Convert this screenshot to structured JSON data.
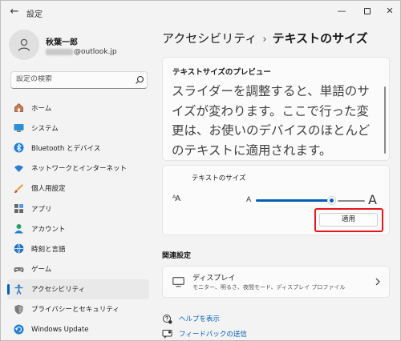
{
  "window": {
    "title": "設定",
    "back_glyph": "←",
    "minimize_glyph": "—",
    "close_glyph": "✕"
  },
  "user": {
    "name": "秋葉一郎",
    "email_domain": "@outlook.jp"
  },
  "search": {
    "placeholder": "設定の検索"
  },
  "nav": {
    "items": [
      {
        "label": "ホーム",
        "icon": "home-icon"
      },
      {
        "label": "システム",
        "icon": "system-icon"
      },
      {
        "label": "Bluetooth とデバイス",
        "icon": "bluetooth-icon"
      },
      {
        "label": "ネットワークとインターネット",
        "icon": "network-icon"
      },
      {
        "label": "個人用設定",
        "icon": "brush-icon"
      },
      {
        "label": "アプリ",
        "icon": "apps-icon"
      },
      {
        "label": "アカウント",
        "icon": "account-icon"
      },
      {
        "label": "時刻と言語",
        "icon": "time-language-icon"
      },
      {
        "label": "ゲーム",
        "icon": "gaming-icon"
      },
      {
        "label": "アクセシビリティ",
        "icon": "accessibility-icon"
      },
      {
        "label": "プライバシーとセキュリティ",
        "icon": "shield-icon"
      },
      {
        "label": "Windows Update",
        "icon": "update-icon"
      }
    ],
    "active_index": 9
  },
  "breadcrumb": {
    "parent": "アクセシビリティ",
    "separator": "›",
    "current": "テキストのサイズ"
  },
  "preview": {
    "title": "テキストサイズのプレビュー",
    "text": "スライダーを調整すると、単語のサイズが変わります。ここで行った変更は、お使いのデバイスのほとんどのテキストに適用されます。"
  },
  "text_size": {
    "label": "テキストのサイズ",
    "aa_glyph": "ᴬA",
    "small_a": "A",
    "large_a": "A",
    "slider_fraction": 0.7,
    "apply_label": "適用"
  },
  "related": {
    "header": "関連設定",
    "display_title": "ディスプレイ",
    "display_subtitle": "モニター、明るさ、夜間モード、ディスプレイ プロファイル"
  },
  "links": {
    "help": "ヘルプを表示",
    "feedback": "フィードバックの送信"
  },
  "colors": {
    "accent": "#005fb8",
    "highlight": "#e8141a",
    "background": "#f3f3f3",
    "card": "#fbfbfb"
  }
}
